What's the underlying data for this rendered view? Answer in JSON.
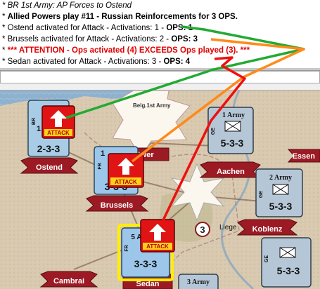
{
  "log": {
    "line1_prefix": "* ",
    "line1_text": "BR 1st Army: AP Forces to Ostend",
    "line2_prefix": "* ",
    "line2_text": "Allied Powers play #11 - Russian Reinforcements for 3 OPS.",
    "line3_text": "* Ostend activated for Attack - Activations: 1 - ",
    "line3_ops": "OPS: 1",
    "line4_text": "* Brussels activated for Attack - Activations: 2 - ",
    "line4_ops": "OPS: 3",
    "line5_prefix": "* ",
    "line5_text": "*** ATTENTION - Ops activated (4) EXCEEDS Ops played (3). ***",
    "line6_text": "* Sedan activated for Attack - Activations: 3 - ",
    "line6_ops": "OPS: 4"
  },
  "map": {
    "spaces": {
      "ostend": "Ostend",
      "antwerp": "Antwer",
      "aachen": "Aachen",
      "essen": "Essen",
      "brussels": "Brussels",
      "liege": "Liege",
      "koblenz": "Koblenz",
      "sedan": "Sedan",
      "cambrai": "Cambrai"
    },
    "belg_army_label": "Belg.1st Army",
    "liege_fort_value": "3",
    "units": {
      "ostend_unit": {
        "nation": "BR",
        "army": "1",
        "strength": "2-3-3",
        "color": "#a9cce6"
      },
      "brussels_unit": {
        "nation": "FR",
        "army": "1",
        "strength": "3-3-3",
        "color": "#9cc6ea"
      },
      "sedan_unit": {
        "nation": "FR",
        "army": "5 A",
        "strength": "3-3-3",
        "color": "#9cc6ea"
      },
      "aachen_unit": {
        "nation": "GE",
        "army": "1 Army",
        "strength": "5-3-3",
        "color": "#b5c7d6"
      },
      "koblenz_unit": {
        "nation": "GE",
        "army": "2 Army",
        "strength": "5-3-3",
        "color": "#b5c7d6"
      },
      "bottom_right_unit": {
        "nation": "GE",
        "army": "",
        "strength": "5-3-3",
        "color": "#b5c7d6"
      },
      "bottom_mid_unit": {
        "nation": "",
        "army": "3 Army",
        "strength": "",
        "color": "#b5c7d6"
      }
    },
    "attack_label": "ATTACK",
    "colors": {
      "attack_red": "#e01414",
      "green_arrow": "#22aa33",
      "orange_arrow": "#ff8a1a",
      "red_arrow": "#ee1010",
      "highlight": "#ffee00",
      "banner": "#9c1a24"
    }
  }
}
